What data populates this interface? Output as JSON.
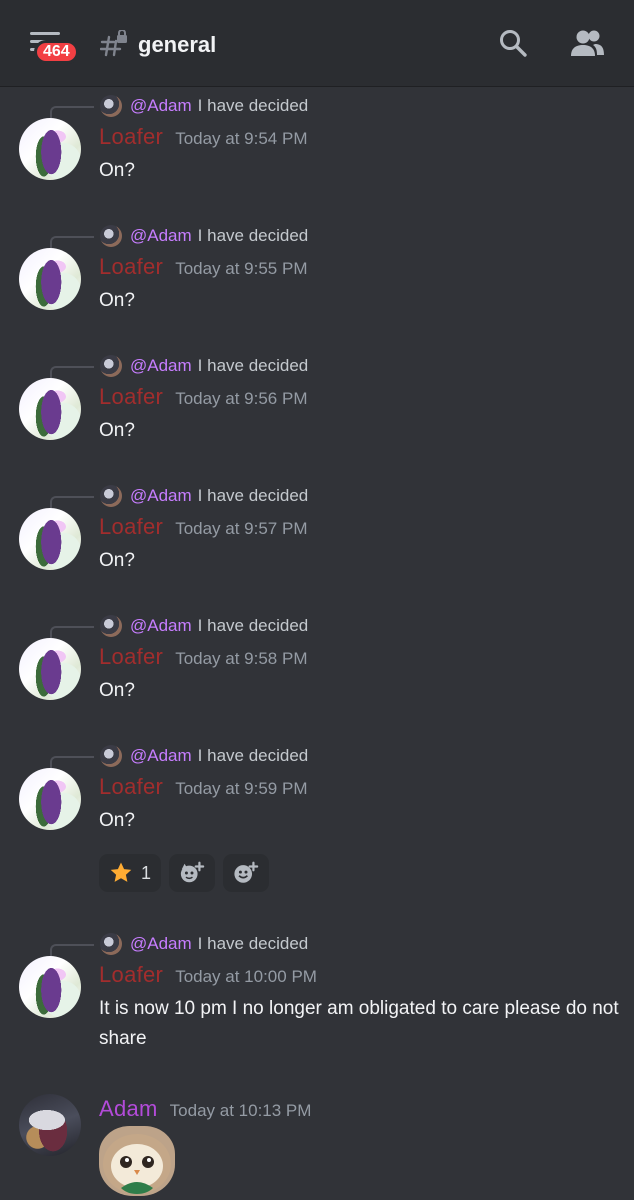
{
  "header": {
    "notification_count": "464",
    "channel_name": "general"
  },
  "reply_preview": {
    "mention": "@Adam",
    "text": "I have decided"
  },
  "messages": [
    {
      "author": "Loafer",
      "time": "Today at 9:54 PM",
      "text": "On?"
    },
    {
      "author": "Loafer",
      "time": "Today at 9:55 PM",
      "text": "On?"
    },
    {
      "author": "Loafer",
      "time": "Today at 9:56 PM",
      "text": "On?"
    },
    {
      "author": "Loafer",
      "time": "Today at 9:57 PM",
      "text": "On?"
    },
    {
      "author": "Loafer",
      "time": "Today at 9:58 PM",
      "text": "On?"
    },
    {
      "author": "Loafer",
      "time": "Today at 9:59 PM",
      "text": "On?"
    },
    {
      "author": "Loafer",
      "time": "Today at 10:00 PM",
      "text": "It is now 10 pm I no longer am obligated to care please do not share"
    },
    {
      "author": "Adam",
      "time": "Today at 10:13 PM",
      "text": ""
    }
  ],
  "reactions": {
    "star_count": "1"
  },
  "colors": {
    "loafer": "#a22d2d",
    "adam": "#b34bd9",
    "mention": "#c77dff",
    "background": "#313338"
  }
}
